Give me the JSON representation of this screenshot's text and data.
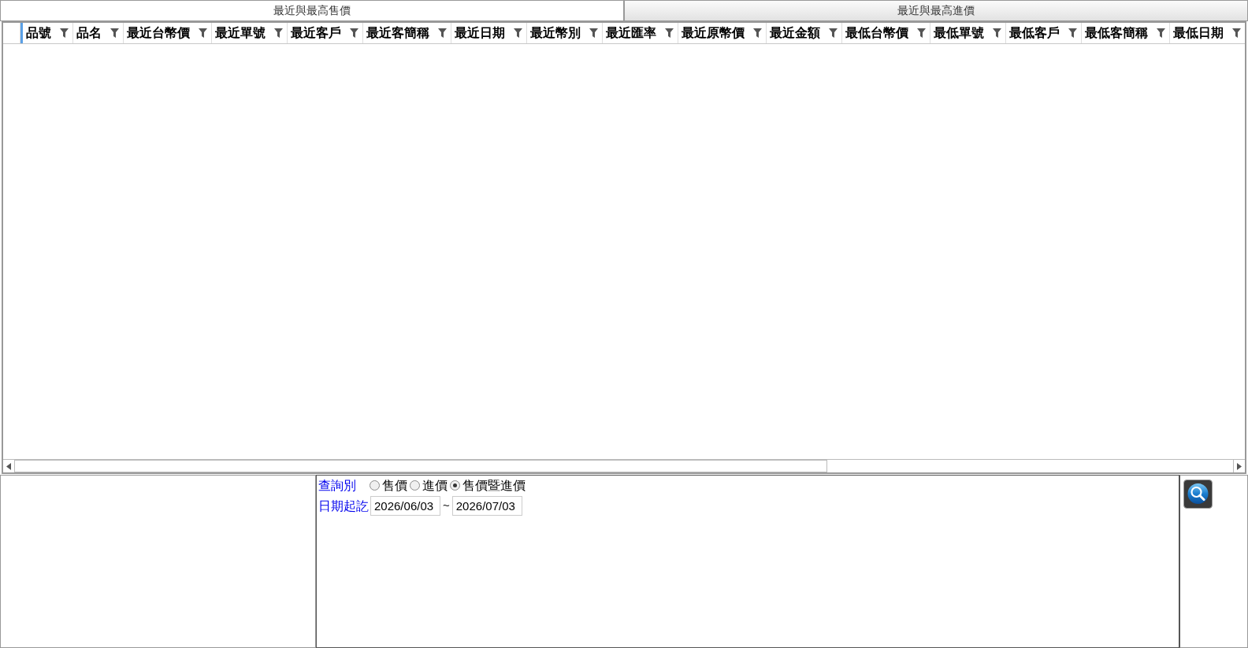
{
  "tabs": [
    {
      "label": "最近與最高售價",
      "selected": true
    },
    {
      "label": "最近與最高進價",
      "selected": false
    }
  ],
  "table": {
    "columns": [
      "品號",
      "品名",
      "最近台幣價",
      "最近單號",
      "最近客戶",
      "最近客簡稱",
      "最近日期",
      "最近幣別",
      "最近匯率",
      "最近原幣價",
      "最近金額",
      "最低台幣價",
      "最低單號",
      "最低客戶",
      "最低客簡稱",
      "最低日期"
    ]
  },
  "query": {
    "type_label": "查詢別",
    "options": [
      {
        "label": "售價",
        "selected": false
      },
      {
        "label": "進價",
        "selected": false
      },
      {
        "label": "售價暨進價",
        "selected": true
      }
    ],
    "date_label": "日期起訖",
    "date_from": "2026/06/03",
    "separator": "~",
    "date_to": "2026/07/03"
  }
}
